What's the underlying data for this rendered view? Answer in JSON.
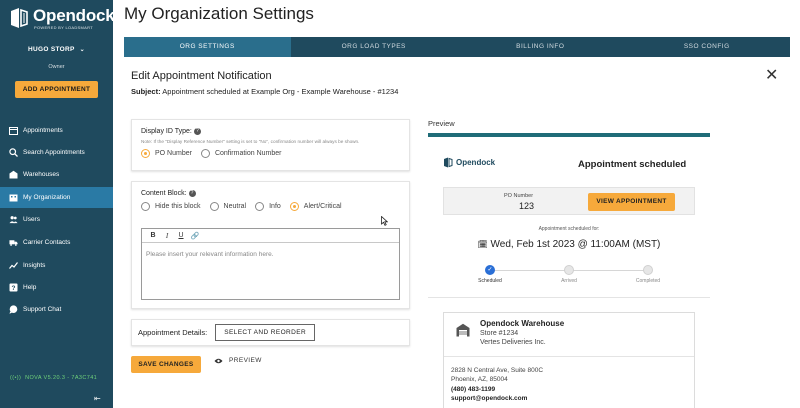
{
  "sidebar": {
    "logo_name": "Opendock",
    "logo_sub": "POWERED BY LOADSMART",
    "user_name": "HUGO STORP",
    "user_role": "Owner",
    "add_button": "ADD APPOINTMENT",
    "items": [
      {
        "label": "Appointments",
        "icon": "appointments-icon",
        "active": false
      },
      {
        "label": "Search Appointments",
        "icon": "search-icon",
        "active": false
      },
      {
        "label": "Warehouses",
        "icon": "warehouse-icon",
        "active": false
      },
      {
        "label": "My Organization",
        "icon": "organization-icon",
        "active": true
      },
      {
        "label": "Users",
        "icon": "users-icon",
        "active": false
      },
      {
        "label": "Carrier Contacts",
        "icon": "truck-icon",
        "active": false
      },
      {
        "label": "Insights",
        "icon": "insights-icon",
        "active": false
      },
      {
        "label": "Help",
        "icon": "help-icon",
        "active": false
      },
      {
        "label": "Support Chat",
        "icon": "chat-icon",
        "active": false
      }
    ],
    "version": "NOVA V5.20.3 - 7A3C741"
  },
  "header": {
    "title": "My Organization Settings",
    "tabs": [
      "ORG SETTINGS",
      "ORG LOAD TYPES",
      "BILLING INFO",
      "SSO CONFIG"
    ],
    "active_tab": 0
  },
  "panel": {
    "title": "Edit Appointment Notification",
    "subject_label": "Subject:",
    "subject_value": "Appointment scheduled at Example Org - Example Warehouse - #1234"
  },
  "display_id": {
    "label": "Display ID Type:",
    "note": "Note: If the \"Display Reference Number\" setting is set to \"No\", confirmation number will always be shown.",
    "options": [
      "PO Number",
      "Confirmation Number"
    ],
    "selected": 0
  },
  "content_block": {
    "label": "Content Block:",
    "options": [
      "Hide this block",
      "Neutral",
      "Info",
      "Alert/Critical"
    ],
    "selected": 3,
    "toolbar": [
      "B",
      "I",
      "U",
      "🔗"
    ],
    "placeholder": "Please insert your relevant information here."
  },
  "details": {
    "label": "Appointment Details:",
    "button": "SELECT AND REORDER"
  },
  "actions": {
    "save": "SAVE CHANGES",
    "preview": "PREVIEW"
  },
  "preview": {
    "title": "Preview",
    "logo_name": "Opendock",
    "heading": "Appointment scheduled",
    "po_label": "PO Number",
    "po_value": "123",
    "view_button": "VIEW APPOINTMENT",
    "scheduled_for": "Appointment scheduled for:",
    "scheduled_time": "Wed, Feb 1st 2023 @ 11:00AM (MST)",
    "steps": [
      {
        "label": "Scheduled",
        "done": true
      },
      {
        "label": "Arrived",
        "done": false
      },
      {
        "label": "Completed",
        "done": false
      }
    ],
    "warehouse": {
      "name": "Opendock Warehouse",
      "store": "Store #1234",
      "company": "Vertes Deliveries Inc.",
      "address1": "2828 N Central Ave, Suite 800C",
      "address2": "Phoenix, AZ, 85004",
      "phone": "(480) 483-1199",
      "email": "support@opendock.com"
    }
  },
  "colors": {
    "sidebar": "#1f4a5e",
    "accent": "#f6a93b",
    "active_nav": "#2a7aa5",
    "preview_bar": "#1f6c78"
  }
}
